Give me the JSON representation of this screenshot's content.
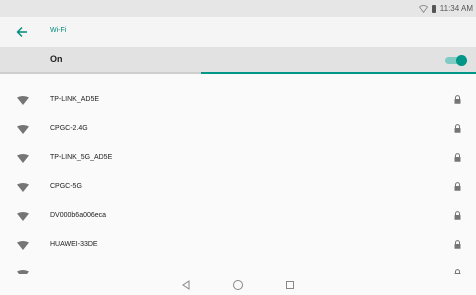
{
  "status_bar": {
    "time": "11:34 AM",
    "wifi_icon": "wifi-outline-icon",
    "battery_icon": "battery-icon"
  },
  "app_bar": {
    "back_icon": "back-arrow-icon",
    "title": "Wi-Fi"
  },
  "toggle": {
    "label": "On",
    "state": "on"
  },
  "networks": [
    {
      "name": "TP-LINK_AD5E"
    },
    {
      "name": "CPGC-2.4G"
    },
    {
      "name": "TP-LINK_5G_AD5E"
    },
    {
      "name": "CPGC-5G"
    },
    {
      "name": "DV000b6a006eca"
    },
    {
      "name": "HUAWEI-33DE"
    },
    {
      "name": ""
    }
  ],
  "nav_bar": {
    "back": "nav-back-icon",
    "home": "nav-home-icon",
    "recents": "nav-recents-icon"
  },
  "colors": {
    "accent": "#009688",
    "title": "#00897b",
    "icon": "#757575"
  }
}
